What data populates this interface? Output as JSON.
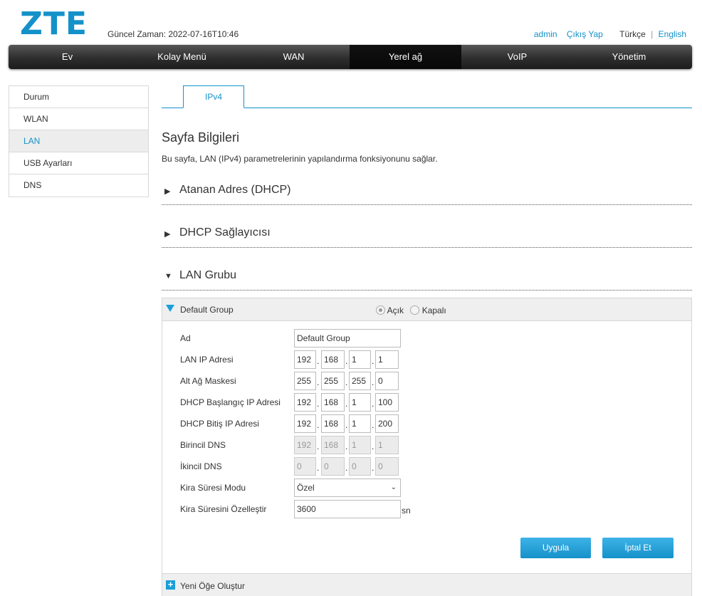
{
  "header": {
    "logo": "ZTE",
    "time": "Güncel Zaman: 2022-07-16T10:46",
    "user": "admin",
    "logout": "Çıkış Yap",
    "lang_tr": "Türkçe",
    "lang_sep": "|",
    "lang_en": "English"
  },
  "nav": [
    "Ev",
    "Kolay Menü",
    "WAN",
    "Yerel ağ",
    "VoIP",
    "Yönetim"
  ],
  "sidebar": [
    "Durum",
    "WLAN",
    "LAN",
    "USB Ayarları",
    "DNS"
  ],
  "tab": "IPv4",
  "page": {
    "title": "Sayfa Bilgileri",
    "desc": "Bu sayfa, LAN (IPv4) parametrelerinin yapılandırma fonksiyonunu sağlar."
  },
  "sections": {
    "dhcp_assigned": "Atanan Adres (DHCP)",
    "dhcp_provider": "DHCP Sağlayıcısı",
    "lan_group": "LAN Grubu"
  },
  "group": {
    "name": "Default Group",
    "radio_on": "Açık",
    "radio_off": "Kapalı",
    "labels": {
      "name": "Ad",
      "lan_ip": "LAN IP Adresi",
      "mask": "Alt Ağ Maskesi",
      "dhcp_start": "DHCP Başlangıç IP Adresi",
      "dhcp_end": "DHCP Bitiş IP Adresi",
      "dns1": "Birincil DNS",
      "dns2": "İkincil DNS",
      "lease_mode": "Kira Süresi Modu",
      "lease_custom": "Kira Süresini Özelleştir"
    },
    "values": {
      "name": "Default Group",
      "lan_ip": [
        "192",
        "168",
        "1",
        "1"
      ],
      "mask": [
        "255",
        "255",
        "255",
        "0"
      ],
      "dhcp_start": [
        "192",
        "168",
        "1",
        "100"
      ],
      "dhcp_end": [
        "192",
        "168",
        "1",
        "200"
      ],
      "dns1": [
        "192",
        "168",
        "1",
        "1"
      ],
      "dns2": [
        "0",
        "0",
        "0",
        "0"
      ],
      "lease_mode": "Özel",
      "lease_custom": "3600",
      "lease_unit": "sn"
    },
    "apply": "Uygula",
    "cancel": "İptal Et",
    "new_item": "Yeni Öğe Oluştur"
  }
}
